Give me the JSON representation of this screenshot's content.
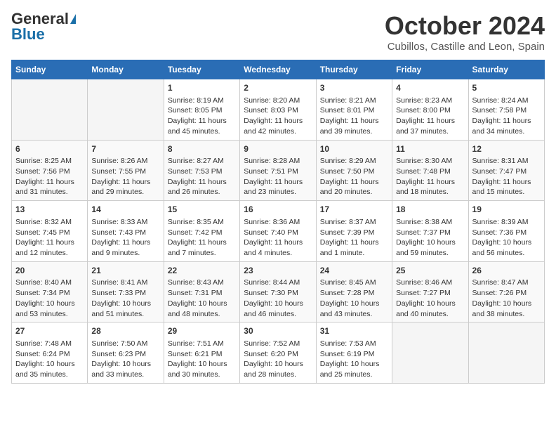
{
  "header": {
    "logo_general": "General",
    "logo_blue": "Blue",
    "month": "October 2024",
    "location": "Cubillos, Castille and Leon, Spain"
  },
  "days_of_week": [
    "Sunday",
    "Monday",
    "Tuesday",
    "Wednesday",
    "Thursday",
    "Friday",
    "Saturday"
  ],
  "weeks": [
    [
      {
        "day": "",
        "info": ""
      },
      {
        "day": "",
        "info": ""
      },
      {
        "day": "1",
        "info": "Sunrise: 8:19 AM\nSunset: 8:05 PM\nDaylight: 11 hours and 45 minutes."
      },
      {
        "day": "2",
        "info": "Sunrise: 8:20 AM\nSunset: 8:03 PM\nDaylight: 11 hours and 42 minutes."
      },
      {
        "day": "3",
        "info": "Sunrise: 8:21 AM\nSunset: 8:01 PM\nDaylight: 11 hours and 39 minutes."
      },
      {
        "day": "4",
        "info": "Sunrise: 8:23 AM\nSunset: 8:00 PM\nDaylight: 11 hours and 37 minutes."
      },
      {
        "day": "5",
        "info": "Sunrise: 8:24 AM\nSunset: 7:58 PM\nDaylight: 11 hours and 34 minutes."
      }
    ],
    [
      {
        "day": "6",
        "info": "Sunrise: 8:25 AM\nSunset: 7:56 PM\nDaylight: 11 hours and 31 minutes."
      },
      {
        "day": "7",
        "info": "Sunrise: 8:26 AM\nSunset: 7:55 PM\nDaylight: 11 hours and 29 minutes."
      },
      {
        "day": "8",
        "info": "Sunrise: 8:27 AM\nSunset: 7:53 PM\nDaylight: 11 hours and 26 minutes."
      },
      {
        "day": "9",
        "info": "Sunrise: 8:28 AM\nSunset: 7:51 PM\nDaylight: 11 hours and 23 minutes."
      },
      {
        "day": "10",
        "info": "Sunrise: 8:29 AM\nSunset: 7:50 PM\nDaylight: 11 hours and 20 minutes."
      },
      {
        "day": "11",
        "info": "Sunrise: 8:30 AM\nSunset: 7:48 PM\nDaylight: 11 hours and 18 minutes."
      },
      {
        "day": "12",
        "info": "Sunrise: 8:31 AM\nSunset: 7:47 PM\nDaylight: 11 hours and 15 minutes."
      }
    ],
    [
      {
        "day": "13",
        "info": "Sunrise: 8:32 AM\nSunset: 7:45 PM\nDaylight: 11 hours and 12 minutes."
      },
      {
        "day": "14",
        "info": "Sunrise: 8:33 AM\nSunset: 7:43 PM\nDaylight: 11 hours and 9 minutes."
      },
      {
        "day": "15",
        "info": "Sunrise: 8:35 AM\nSunset: 7:42 PM\nDaylight: 11 hours and 7 minutes."
      },
      {
        "day": "16",
        "info": "Sunrise: 8:36 AM\nSunset: 7:40 PM\nDaylight: 11 hours and 4 minutes."
      },
      {
        "day": "17",
        "info": "Sunrise: 8:37 AM\nSunset: 7:39 PM\nDaylight: 11 hours and 1 minute."
      },
      {
        "day": "18",
        "info": "Sunrise: 8:38 AM\nSunset: 7:37 PM\nDaylight: 10 hours and 59 minutes."
      },
      {
        "day": "19",
        "info": "Sunrise: 8:39 AM\nSunset: 7:36 PM\nDaylight: 10 hours and 56 minutes."
      }
    ],
    [
      {
        "day": "20",
        "info": "Sunrise: 8:40 AM\nSunset: 7:34 PM\nDaylight: 10 hours and 53 minutes."
      },
      {
        "day": "21",
        "info": "Sunrise: 8:41 AM\nSunset: 7:33 PM\nDaylight: 10 hours and 51 minutes."
      },
      {
        "day": "22",
        "info": "Sunrise: 8:43 AM\nSunset: 7:31 PM\nDaylight: 10 hours and 48 minutes."
      },
      {
        "day": "23",
        "info": "Sunrise: 8:44 AM\nSunset: 7:30 PM\nDaylight: 10 hours and 46 minutes."
      },
      {
        "day": "24",
        "info": "Sunrise: 8:45 AM\nSunset: 7:28 PM\nDaylight: 10 hours and 43 minutes."
      },
      {
        "day": "25",
        "info": "Sunrise: 8:46 AM\nSunset: 7:27 PM\nDaylight: 10 hours and 40 minutes."
      },
      {
        "day": "26",
        "info": "Sunrise: 8:47 AM\nSunset: 7:26 PM\nDaylight: 10 hours and 38 minutes."
      }
    ],
    [
      {
        "day": "27",
        "info": "Sunrise: 7:48 AM\nSunset: 6:24 PM\nDaylight: 10 hours and 35 minutes."
      },
      {
        "day": "28",
        "info": "Sunrise: 7:50 AM\nSunset: 6:23 PM\nDaylight: 10 hours and 33 minutes."
      },
      {
        "day": "29",
        "info": "Sunrise: 7:51 AM\nSunset: 6:21 PM\nDaylight: 10 hours and 30 minutes."
      },
      {
        "day": "30",
        "info": "Sunrise: 7:52 AM\nSunset: 6:20 PM\nDaylight: 10 hours and 28 minutes."
      },
      {
        "day": "31",
        "info": "Sunrise: 7:53 AM\nSunset: 6:19 PM\nDaylight: 10 hours and 25 minutes."
      },
      {
        "day": "",
        "info": ""
      },
      {
        "day": "",
        "info": ""
      }
    ]
  ]
}
